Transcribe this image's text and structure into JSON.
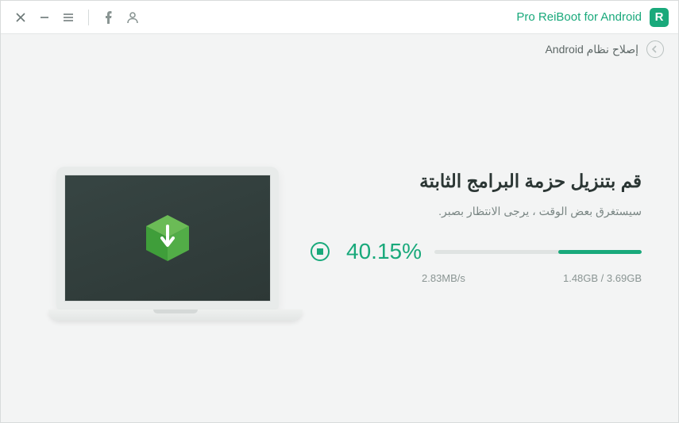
{
  "titlebar": {
    "app_title": "Pro ReiBoot for Android",
    "logo_letter": "R"
  },
  "breadcrumb": {
    "label": "إصلاح نظام Android"
  },
  "main": {
    "heading": "قم بتنزيل حزمة البرامج الثابتة",
    "subtext": "سيستغرق بعض الوقت ، يرجى الانتظار بصبر.",
    "percent": "40.15%",
    "progress_value": 40.15,
    "speed": "2.83MB/s",
    "size": "1.48GB / 3.69GB"
  }
}
